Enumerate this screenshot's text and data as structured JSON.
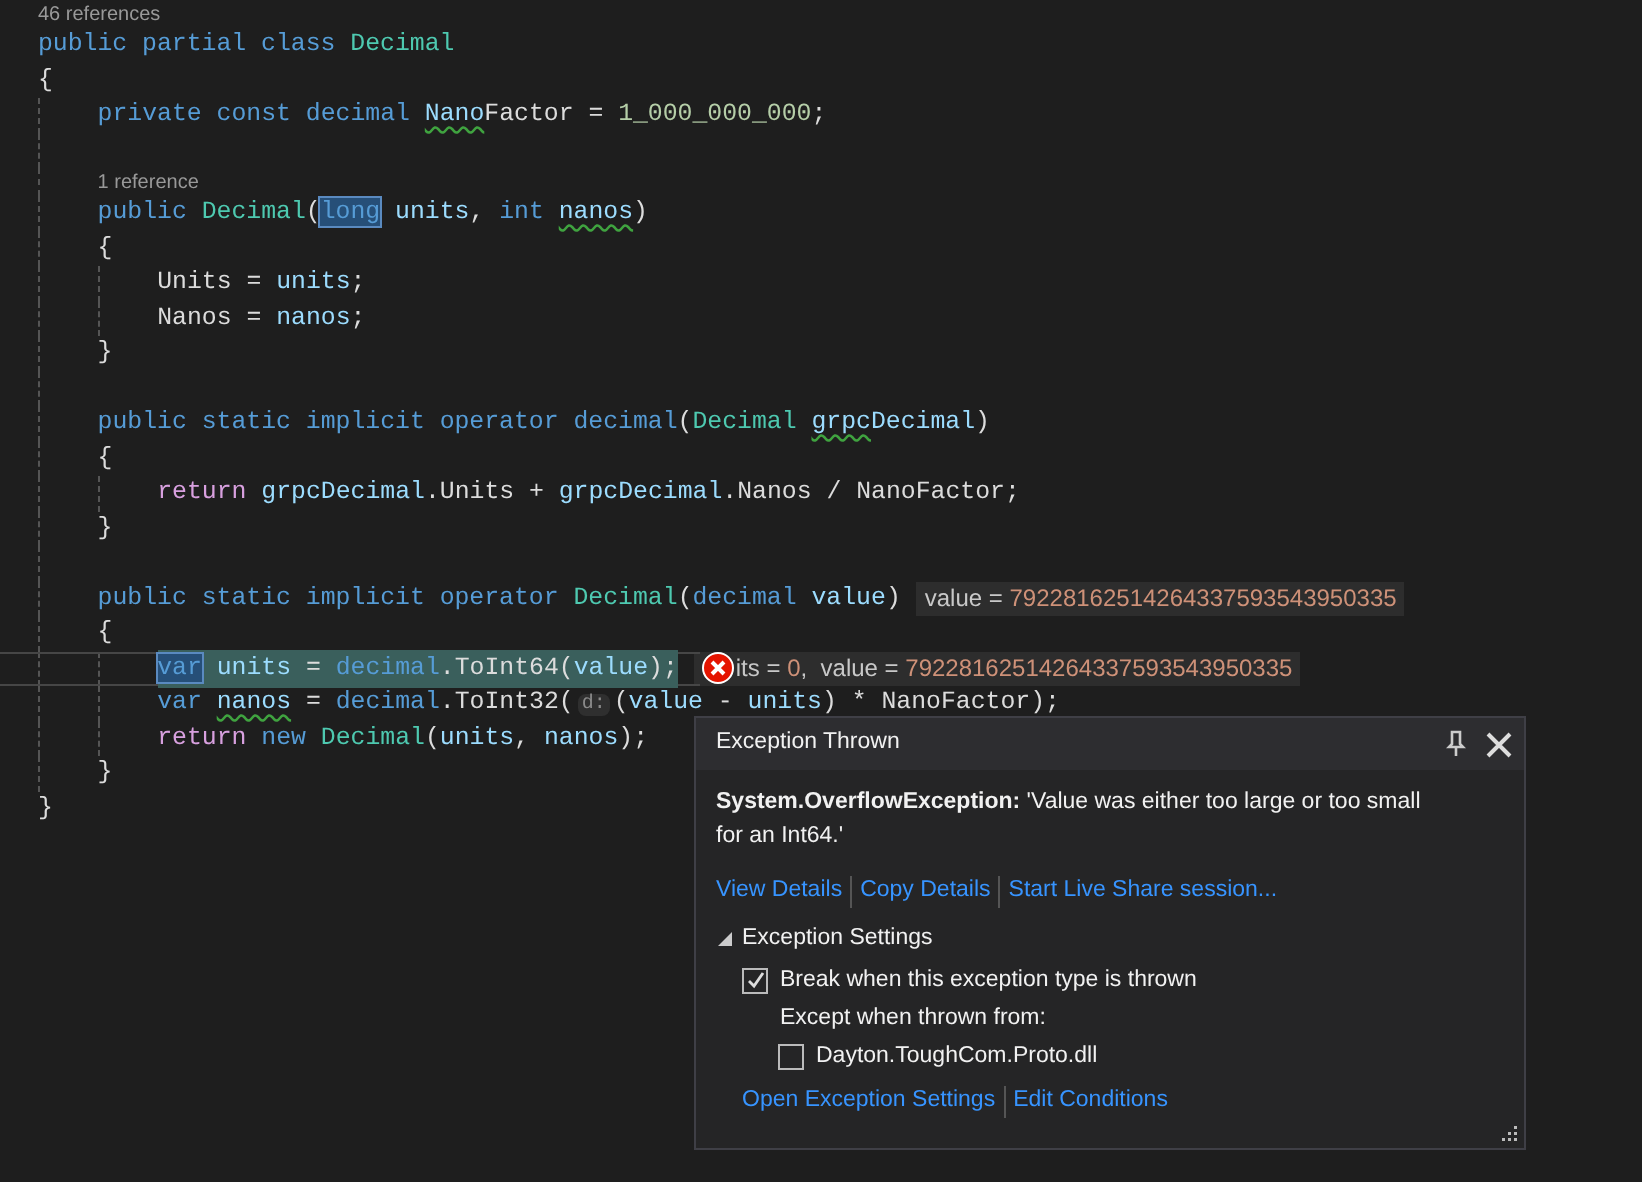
{
  "editor": {
    "lines": [
      {
        "kind": "lens",
        "text": "46 references"
      },
      {
        "kind": "code",
        "tokens": [
          {
            "t": "public partial class ",
            "kind": "kw"
          },
          {
            "t": "Decimal",
            "kind": "type"
          }
        ]
      },
      {
        "kind": "code",
        "tokens": [
          {
            "t": "{",
            "kind": "plain"
          }
        ],
        "children": [
          {
            "kind": "code",
            "tokens": [
              {
                "t": "private const decimal ",
                "kind": "kw"
              },
              {
                "t": "Nano",
                "kind": "warn"
              },
              {
                "t": "Factor = ",
                "kind": "plain"
              },
              {
                "t": "1_000_000_000",
                "kind": "num"
              },
              {
                "t": ";",
                "kind": "plain"
              }
            ]
          },
          {
            "kind": "blank"
          },
          {
            "kind": "lens",
            "text": "1 reference"
          },
          {
            "kind": "code",
            "tokens": [
              {
                "t": "public ",
                "kind": "kw"
              },
              {
                "t": "Decimal",
                "kind": "type"
              },
              {
                "t": "(",
                "kind": "plain"
              },
              {
                "t": "long",
                "kind": "kwsel"
              },
              {
                "t": " units",
                "kind": "ident"
              },
              {
                "t": ", ",
                "kind": "plain"
              },
              {
                "t": "int ",
                "kind": "kw"
              },
              {
                "t": "nanos",
                "kind": "warn"
              },
              {
                "t": ")",
                "kind": "plain"
              }
            ]
          },
          {
            "kind": "code",
            "tokens": [
              {
                "t": "{",
                "kind": "plain"
              }
            ],
            "children": [
              {
                "kind": "code",
                "tokens": [
                  {
                    "t": "Units = ",
                    "kind": "plain"
                  },
                  {
                    "t": "units",
                    "kind": "ident"
                  },
                  {
                    "t": ";",
                    "kind": "plain"
                  }
                ]
              },
              {
                "kind": "code",
                "tokens": [
                  {
                    "t": "Nanos = ",
                    "kind": "plain"
                  },
                  {
                    "t": "nanos",
                    "kind": "ident"
                  },
                  {
                    "t": ";",
                    "kind": "plain"
                  }
                ]
              }
            ]
          },
          {
            "kind": "code",
            "tokens": [
              {
                "t": "}",
                "kind": "plain"
              }
            ]
          },
          {
            "kind": "blank"
          },
          {
            "kind": "code",
            "tokens": [
              {
                "t": "public static implicit operator decimal",
                "kind": "kw"
              },
              {
                "t": "(",
                "kind": "plain"
              },
              {
                "t": "Decimal ",
                "kind": "type"
              },
              {
                "t": "grpc",
                "kind": "warn"
              },
              {
                "t": "Decimal",
                "kind": "ident"
              },
              {
                "t": ")",
                "kind": "plain"
              }
            ]
          },
          {
            "kind": "code",
            "tokens": [
              {
                "t": "{",
                "kind": "plain"
              }
            ],
            "children": [
              {
                "kind": "code",
                "tokens": [
                  {
                    "t": "return ",
                    "kind": "ctrl"
                  },
                  {
                    "t": "grpcDecimal",
                    "kind": "ident"
                  },
                  {
                    "t": ".Units + ",
                    "kind": "plain"
                  },
                  {
                    "t": "grpcDecimal",
                    "kind": "ident"
                  },
                  {
                    "t": ".Nanos / NanoFactor;",
                    "kind": "plain"
                  }
                ]
              }
            ]
          },
          {
            "kind": "code",
            "tokens": [
              {
                "t": "}",
                "kind": "plain"
              }
            ]
          },
          {
            "kind": "blank"
          },
          {
            "kind": "code",
            "tokens": [
              {
                "t": "public static implicit operator ",
                "kind": "kw"
              },
              {
                "t": "Decimal",
                "kind": "type"
              },
              {
                "t": "(",
                "kind": "plain"
              },
              {
                "t": "decimal ",
                "kind": "kw"
              },
              {
                "t": "value",
                "kind": "ident"
              },
              {
                "t": ")",
                "kind": "plain"
              }
            ],
            "datatip": {
              "kind": "value",
              "name": "value = ",
              "value": "79228162514264337593543950335"
            }
          },
          {
            "kind": "code",
            "tokens": [
              {
                "t": "{",
                "kind": "plain"
              }
            ],
            "children": [
              {
                "kind": "current",
                "tokens": [
                  {
                    "t": "var",
                    "kind": "kwsel"
                  },
                  {
                    "t": " units",
                    "kind": "ident"
                  },
                  {
                    "t": " = ",
                    "kind": "plain"
                  },
                  {
                    "t": "decimal",
                    "kind": "kw"
                  },
                  {
                    "t": ".ToInt64(",
                    "kind": "plain"
                  },
                  {
                    "t": "value",
                    "kind": "ident"
                  },
                  {
                    "t": ");",
                    "kind": "plain"
                  }
                ],
                "datatip": {
                  "kind": "error",
                  "name": "its = ",
                  "value": "0",
                  "name2": ",  value = ",
                  "value2": "79228162514264337593543950335"
                }
              },
              {
                "kind": "code",
                "tokens": [
                  {
                    "t": "var ",
                    "kind": "kw"
                  },
                  {
                    "t": "nanos",
                    "kind": "warn"
                  },
                  {
                    "t": " = ",
                    "kind": "plain"
                  },
                  {
                    "t": "decimal",
                    "kind": "kw"
                  },
                  {
                    "t": ".ToInt32(",
                    "kind": "plain"
                  },
                  {
                    "t": "d:",
                    "kind": "hint"
                  },
                  {
                    "t": "(",
                    "kind": "plain"
                  },
                  {
                    "t": "value",
                    "kind": "ident"
                  },
                  {
                    "t": " - ",
                    "kind": "plain"
                  },
                  {
                    "t": "units",
                    "kind": "ident"
                  },
                  {
                    "t": ") * NanoFactor);",
                    "kind": "plain"
                  }
                ]
              },
              {
                "kind": "code",
                "tokens": [
                  {
                    "t": "return ",
                    "kind": "ctrl"
                  },
                  {
                    "t": "new ",
                    "kind": "kw"
                  },
                  {
                    "t": "Decimal",
                    "kind": "type"
                  },
                  {
                    "t": "(",
                    "kind": "plain"
                  },
                  {
                    "t": "units",
                    "kind": "ident"
                  },
                  {
                    "t": ", ",
                    "kind": "plain"
                  },
                  {
                    "t": "nanos",
                    "kind": "ident"
                  },
                  {
                    "t": ");",
                    "kind": "plain"
                  }
                ]
              }
            ]
          },
          {
            "kind": "code",
            "tokens": [
              {
                "t": "}",
                "kind": "plain"
              }
            ]
          }
        ]
      },
      {
        "kind": "code",
        "tokens": [
          {
            "t": "}",
            "kind": "plain"
          }
        ]
      }
    ]
  },
  "exception_popup": {
    "title": "Exception Thrown",
    "message": "**System.OverflowException:** 'Value was either too large or too small for an Int64.'",
    "links": [
      "View Details",
      "Copy Details",
      "Start Live Share session..."
    ],
    "settings": {
      "label": "Exception Settings",
      "expanded": true,
      "break_option": {
        "label": "Break when this exception type is thrown",
        "checked": true
      },
      "except_label": "Except when thrown from:",
      "modules": [
        {
          "label": "Dayton.ToughCom.Proto.dll",
          "checked": false
        }
      ],
      "links": [
        "Open Exception Settings",
        "Edit Conditions"
      ]
    }
  }
}
